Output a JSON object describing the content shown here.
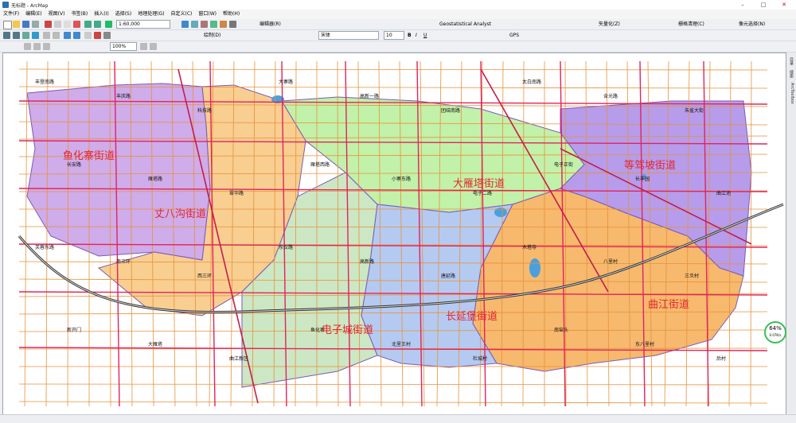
{
  "window": {
    "title": "无标题 - ArcMap"
  },
  "menu": [
    "文件(F)",
    "编辑(E)",
    "视图(V)",
    "书签(B)",
    "插入(I)",
    "选择(S)",
    "地理处理(G)",
    "自定义(C)",
    "窗口(W)",
    "帮助(H)"
  ],
  "toolbar": {
    "scale": "1:60,000",
    "editor_label": "编辑器(R)",
    "geostat_label": "Geostatistical Analyst",
    "vectorize_label": "矢量化(Z)",
    "raster_clean_label": "栅格清理(C)",
    "raster_label": "像元选择(N)",
    "draw_label": "绘制(D)",
    "font_name": "宋体",
    "font_size": "10",
    "bold": "B",
    "italic": "I",
    "underline": "U",
    "gps_label": "GPS",
    "zoom_percent": "100%"
  },
  "dock": {
    "items": [
      "目录",
      "搜索",
      "ArcToolbox"
    ]
  },
  "zoom_widget": {
    "value": "64%",
    "sub": "0.07K/s"
  },
  "map": {
    "districts": [
      {
        "name": "鱼化寨街道",
        "color": "#c79ee6"
      },
      {
        "name": "丈八沟街道",
        "color": "#f7c57e"
      },
      {
        "name": "大雁塔街道",
        "color": "#b7ef9a"
      },
      {
        "name": "等驾坡街道",
        "color": "#a98be8"
      },
      {
        "name": "曲江街道",
        "color": "#f5ad55"
      },
      {
        "name": "电子城街道",
        "color": "#c3e3b8"
      },
      {
        "name": "长延堡街道",
        "color": "#a8c1ee"
      }
    ],
    "labels": [
      "鱼化寨街道",
      "丈八沟街道",
      "大雁塔街道",
      "等驾坡街道",
      "曲江街道",
      "电子城街道",
      "长延堡街道"
    ],
    "places": [
      "丰登南路",
      "丰庆路",
      "科技路",
      "大寨路",
      "高新一路",
      "团结南路",
      "太白南路",
      "含光路",
      "朱雀大街",
      "长安路",
      "雁塔路",
      "翠华路",
      "雁塔西路",
      "小寨东路",
      "电子二路",
      "电子正街",
      "长丰园",
      "曲江池",
      "芙蓉东路",
      "南三环",
      "西三环",
      "东仪路",
      "高新路",
      "唐延路",
      "木塔寺",
      "八里村",
      "三爻村",
      "新开门",
      "大雁塔",
      "曲江新区",
      "鱼化寨",
      "北里王村",
      "杜城村",
      "南窑头",
      "东八里村",
      "后村"
    ]
  }
}
